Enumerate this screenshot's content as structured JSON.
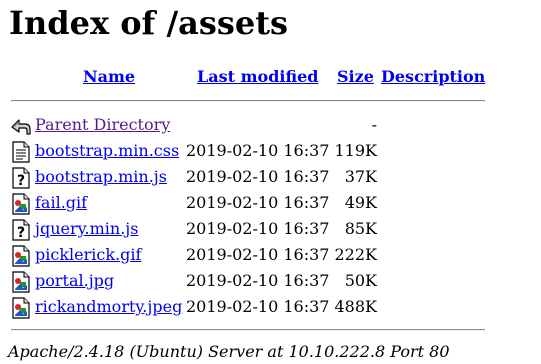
{
  "page": {
    "title": "Index of /assets"
  },
  "columns": {
    "name": "Name",
    "last_modified": "Last modified",
    "size": "Size",
    "description": "Description"
  },
  "entries": [
    {
      "name": "Parent Directory",
      "date": "",
      "size": "-",
      "icon": "back-arrow-icon"
    },
    {
      "name": "bootstrap.min.css",
      "date": "2019-02-10 16:37",
      "size": "119K",
      "icon": "text-file-icon"
    },
    {
      "name": "bootstrap.min.js",
      "date": "2019-02-10 16:37",
      "size": " 37K",
      "icon": "unknown-file-icon"
    },
    {
      "name": "fail.gif",
      "date": "2019-02-10 16:37",
      "size": " 49K",
      "icon": "image-file-icon"
    },
    {
      "name": "jquery.min.js",
      "date": "2019-02-10 16:37",
      "size": " 85K",
      "icon": "unknown-file-icon"
    },
    {
      "name": "picklerick.gif",
      "date": "2019-02-10 16:37",
      "size": "222K",
      "icon": "image-file-icon"
    },
    {
      "name": "portal.jpg",
      "date": "2019-02-10 16:37",
      "size": " 50K",
      "icon": "image-file-icon"
    },
    {
      "name": "rickandmorty.jpeg",
      "date": "2019-02-10 16:37",
      "size": "488K",
      "icon": "image-file-icon"
    }
  ],
  "footer": {
    "signature": "Apache/2.4.18 (Ubuntu) Server at 10.10.222.8 Port 80"
  },
  "colors": {
    "link": "#0000ee",
    "visited_link": "#551a8b"
  }
}
